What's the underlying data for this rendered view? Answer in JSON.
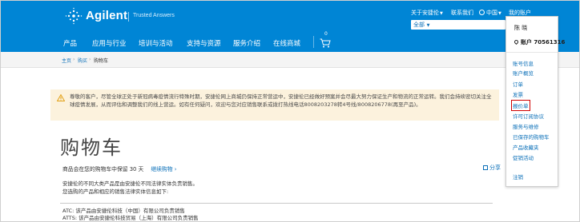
{
  "brand": {
    "name": "Agilent",
    "tagline": "Trusted Answers"
  },
  "utility": {
    "about": "关于安捷伦",
    "contact": "联系我们",
    "region": "中国",
    "account": "我的账户"
  },
  "search": {
    "scope": "全部"
  },
  "nav": [
    "产品",
    "应用与行业",
    "培训与活动",
    "支持与资源",
    "服务介绍",
    "在线商城"
  ],
  "cart": {
    "count": "0"
  },
  "breadcrumb": [
    "主页",
    "购买",
    "购物车"
  ],
  "alert": {
    "text": "尊敬的客户，尽管全球正处于新冠病毒疫情流行特殊时期，安捷伦网上商城仍保持正常营运中，安捷伦已经做好预案并会尽最大努力保证生产和物流的正常运转。我们会持续密切关注全球疫情发展，从而评估和调整我们的线上营运。如有任何疑问，欢迎与您对应销售联系或拨打热线电话8008203278转4号线/8008206778(再至产品)。"
  },
  "page": {
    "title": "购物车",
    "retention": "商品会在您的购物车中保留 30 天",
    "continue_shopping": "继续购物 ›",
    "share": "分享",
    "note1": "安捷伦的不同大类产品是由安捷伦不同法律实体负责销售。",
    "note2": "您选购的产品和相应的销售法律实体信息如下:",
    "atc": "ATC: 该产品由安捷伦科技（中国）有限公司负责销售",
    "atts": "ATTS: 该产品由安捷伦科技贸易（上海）有限公司负责销售"
  },
  "dropdown": {
    "user": "陈 晓",
    "account_label": "账户 70561316",
    "items": [
      "账号信息",
      "账户概览",
      "订单",
      "发票",
      "报价单",
      "许可订阅协议",
      "服务与维修",
      "已保存的购物车",
      "产品收藏夹",
      "促销活动",
      "注销"
    ],
    "highlighted": "报价单"
  },
  "colors": {
    "brand_blue": "#0085d5",
    "link": "#0a6fb8",
    "alert_bg": "#fcf2dd",
    "highlight": "#d00000"
  }
}
